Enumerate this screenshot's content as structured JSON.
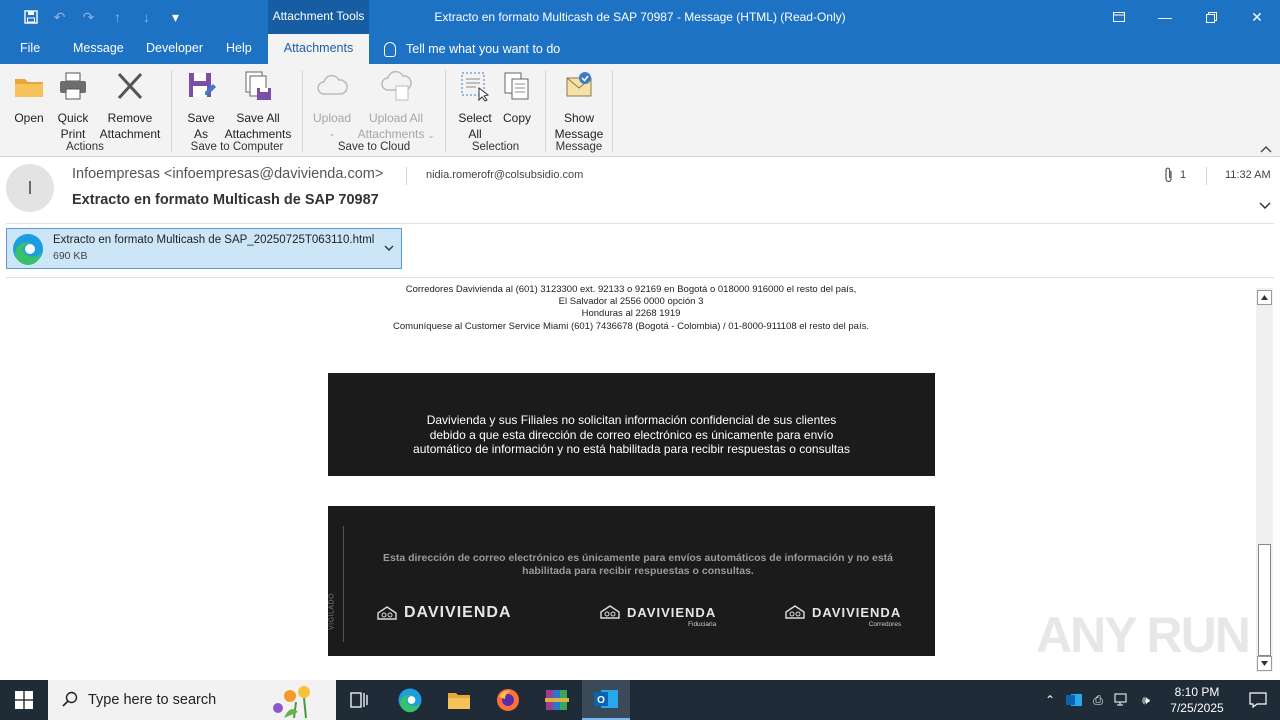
{
  "window": {
    "context_tab_group": "Attachment Tools",
    "title": "Extracto en formato Multicash de SAP 70987  -  Message (HTML) (Read-Only)"
  },
  "tabs": [
    "File",
    "Message",
    "Developer",
    "Help",
    "Attachments"
  ],
  "tell_me": "Tell me what you want to do",
  "ribbon": {
    "open": "Open",
    "quick_print": [
      "Quick",
      "Print"
    ],
    "remove_attachment": [
      "Remove",
      "Attachment"
    ],
    "group_actions": "Actions",
    "save_as": [
      "Save",
      "As"
    ],
    "save_all": [
      "Save All",
      "Attachments"
    ],
    "group_save_computer": "Save to Computer",
    "upload": "Upload",
    "upload_all": [
      "Upload All",
      "Attachments"
    ],
    "group_save_cloud": "Save to Cloud",
    "select_all": [
      "Select",
      "All"
    ],
    "copy": "Copy",
    "group_selection": "Selection",
    "show_message": [
      "Show",
      "Message"
    ],
    "group_message": "Message"
  },
  "header": {
    "avatar_initial": "I",
    "from": "Infoempresas <infoempresas@davivienda.com>",
    "to": "nidia.romerofr@colsubsidio.com",
    "subject": "Extracto en formato Multicash de SAP 70987",
    "attachment_count": "1",
    "time": "11:32 AM"
  },
  "attachment": {
    "name": "Extracto en formato Multicash de SAP_20250725T063110.html",
    "size": "690 KB"
  },
  "body": {
    "contact_lines": [
      "Corredores Davivienda al (601) 3123300 ext. 92133 o 92169 en Bogotá o 018000 916000 el resto del país,",
      "El Salvador al 2556 0000 opción 3",
      "Honduras al 2268 1919",
      "Comuníquese al Customer Service Miami (601) 7436678 (Bogotá - Colombia) / 01-8000-911108 el resto del país."
    ],
    "warning_lines": [
      "Davivienda y sus Filiales no solicitan información confidencial de sus clientes",
      "debido a que esta dirección de correo electrónico es únicamente para envío",
      "automático de información y no está habilitada para recibir respuestas o consultas"
    ],
    "notice_lines": [
      "Esta dirección de correo electrónico es únicamente para envíos automáticos de información y no está",
      "habilitada para recibir respuestas o consultas."
    ],
    "vigilado": "VIGILADO",
    "logos": [
      {
        "word": "DAVIVIENDA",
        "sub": ""
      },
      {
        "word": "DAVIVIENDA",
        "sub": "Fiduciaria"
      },
      {
        "word": "DAVIVIENDA",
        "sub": "Corredores"
      }
    ]
  },
  "watermark": "ANY RUN",
  "taskbar": {
    "search_placeholder": "Type here to search",
    "time": "8:10 PM",
    "date": "7/25/2025"
  },
  "colors": {
    "titlebar": "#1e72c4",
    "ribbon": "#f3f3f3",
    "attachment_bg": "#cde6f7",
    "dark_block": "#1b1b1b",
    "taskbar": "#1f2b36"
  }
}
